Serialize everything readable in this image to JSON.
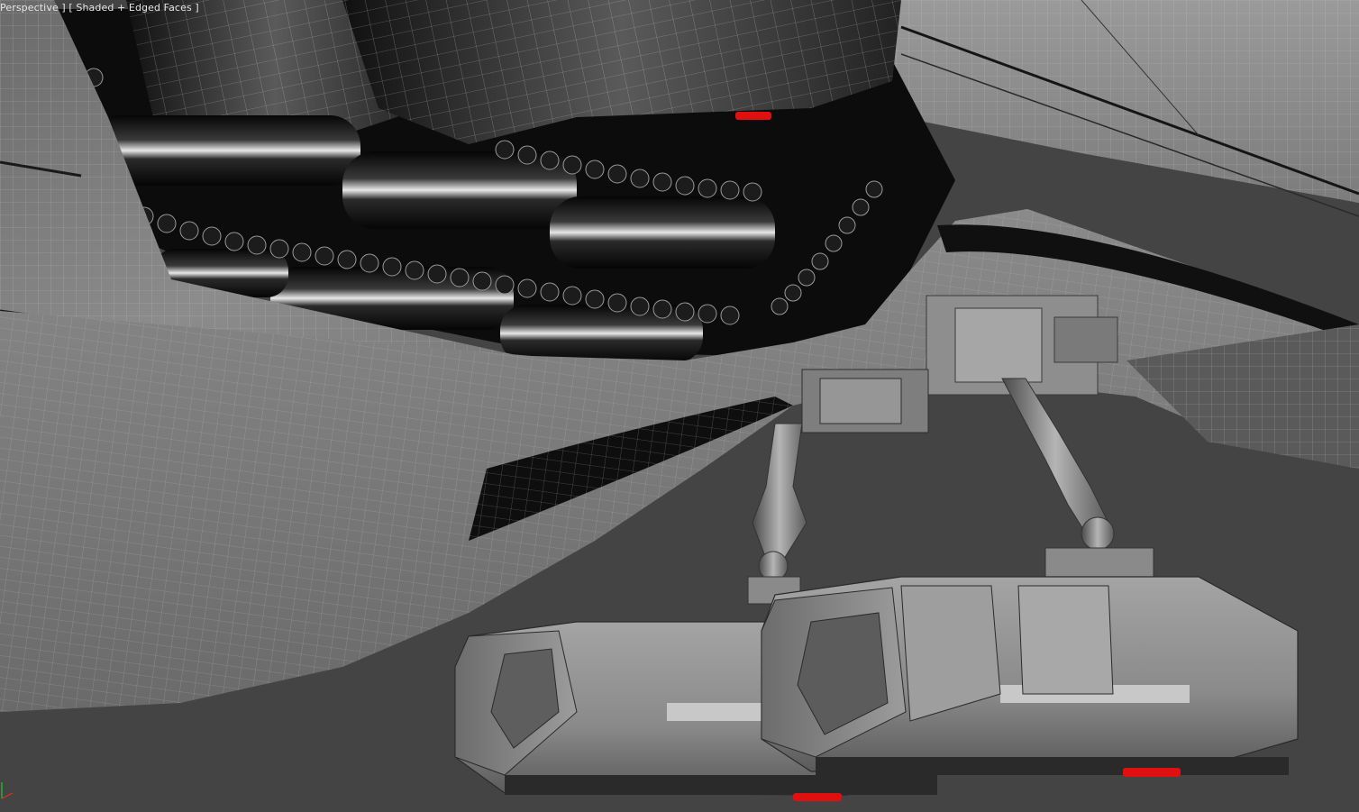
{
  "viewport": {
    "label": "Perspective ] [ Shaded + Edged Faces ]",
    "view": "Perspective",
    "shading_mode": "Shaded + Edged Faces"
  },
  "colors": {
    "background": "#444444",
    "hull_light": "#8a8a8a",
    "hull_mid": "#6e6e6e",
    "cavity_dark": "#111111",
    "wire": "#d8d8d8",
    "light_marker": "#e01010",
    "axis_x": "#d03020",
    "axis_y": "#20b030"
  },
  "icons": {
    "axis_gizmo": "axis-tripod-icon"
  }
}
